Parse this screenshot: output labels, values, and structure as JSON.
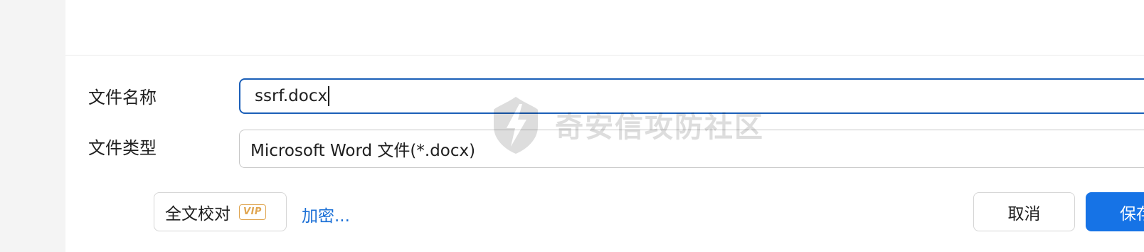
{
  "form": {
    "filename_label": "文件名称",
    "filename_value": "ssrf.docx",
    "filetype_label": "文件类型",
    "filetype_value": "Microsoft Word 文件(*.docx)"
  },
  "actions": {
    "proofread_label": "全文校对",
    "vip_badge": "VIP",
    "encrypt_label": "加密...",
    "cancel_label": "取消",
    "save_label": "保存"
  },
  "watermark": {
    "text": "奇安信攻防社区"
  },
  "colors": {
    "primary": "#1673e6",
    "focus_border": "#1b5fb8",
    "link": "#1a6fd6",
    "vip": "#e0a550"
  },
  "icons": {
    "dropdown": "chevron-down-icon",
    "watermark_logo": "lightning-shield-icon"
  }
}
